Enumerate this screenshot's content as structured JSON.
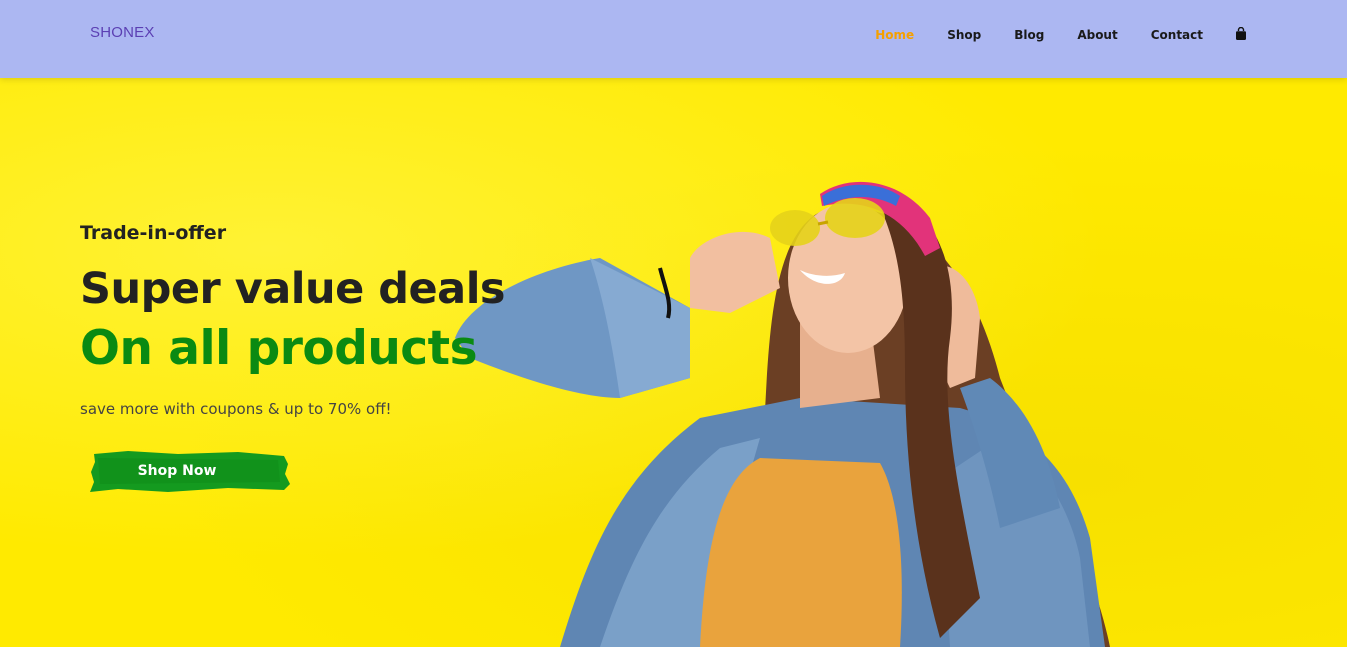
{
  "header": {
    "logo": "SHONEX",
    "nav": [
      {
        "label": "Home",
        "active": true
      },
      {
        "label": "Shop",
        "active": false
      },
      {
        "label": "Blog",
        "active": false
      },
      {
        "label": "About",
        "active": false
      },
      {
        "label": "Contact",
        "active": false
      }
    ],
    "cart_icon": "shopping-bag-icon"
  },
  "hero": {
    "eyebrow": "Trade-in-offer",
    "title_line1": "Super value deals",
    "title_line2": "On all products",
    "subtitle": "save more with coupons & up to 70% off!",
    "cta_label": "Shop Now"
  },
  "colors": {
    "header_bg": "#acb7f2",
    "hero_bg": "#ffea00",
    "accent_green": "#0a8a12",
    "active_nav": "#f5a000",
    "logo": "#5b3fb3"
  }
}
